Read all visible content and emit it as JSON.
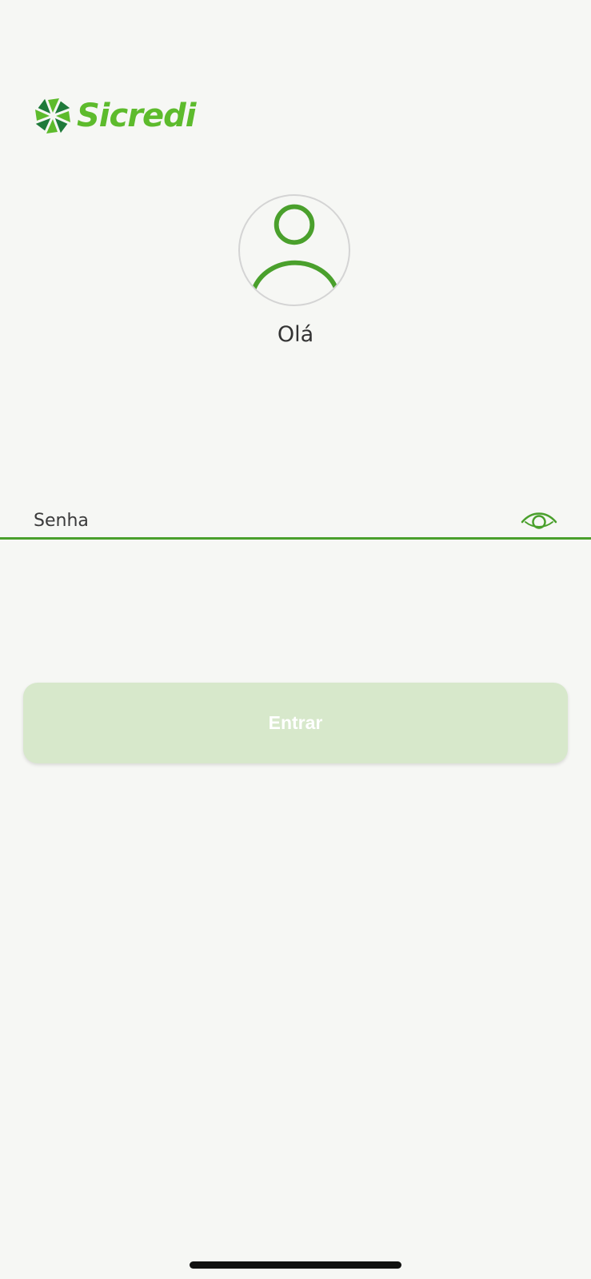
{
  "brand": {
    "name": "Sicredi",
    "color": "#5dbb2c",
    "dark_color": "#1f7a3a",
    "logo_icon": "sicredi-pinwheel-icon"
  },
  "profile": {
    "avatar_icon": "user-avatar-icon",
    "greeting": "Olá"
  },
  "password": {
    "label": "Senha",
    "value": "",
    "toggle_icon": "eye-icon"
  },
  "actions": {
    "submit_label": "Entrar",
    "submit_color": "#d7e8cb"
  },
  "colors": {
    "accent": "#4aa02c",
    "background": "#f6f7f4"
  }
}
